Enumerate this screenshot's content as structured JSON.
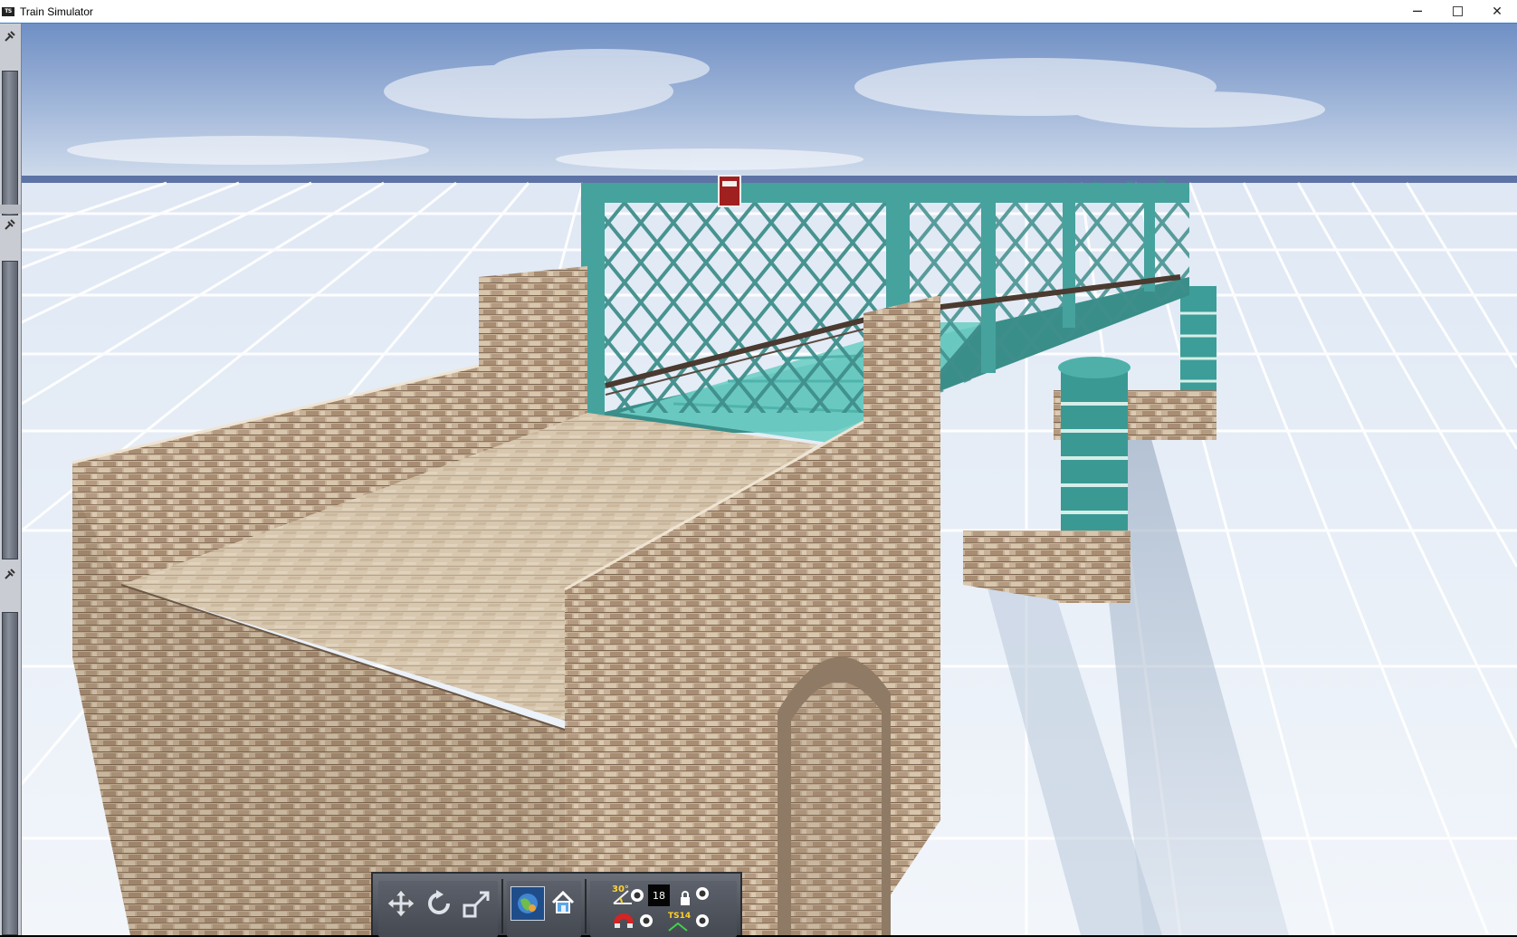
{
  "window": {
    "title": "Train Simulator",
    "app_icon_label": "TS",
    "controls": {
      "minimize": "─",
      "close": "✕"
    }
  },
  "sidebar": {
    "handles": [
      "pin-icon",
      "pin-icon",
      "pin-icon"
    ]
  },
  "toolbar": {
    "groups": [
      {
        "name": "camera-tools",
        "buttons": [
          "move-icon",
          "rotate-icon",
          "scale-icon"
        ]
      },
      {
        "name": "navigation",
        "buttons": [
          "world-globe-icon",
          "home-icon"
        ]
      },
      {
        "name": "settings",
        "buttons": [
          "30-degree-snap-icon",
          "snap-toggle",
          "grid-size",
          "lock-icon",
          "lock-toggle",
          "magnet-icon",
          "magnet-toggle",
          "ts14-icon",
          "ts14-toggle"
        ]
      }
    ],
    "snap_angle_label": "30°",
    "grid_size_value": "18",
    "ts_label": "TS14"
  },
  "colors": {
    "sky_top": "#6f8fc4",
    "sky_horizon": "#c9d6ea",
    "ground": "#e9f1f9",
    "grid_lines": "#ffffff",
    "bridge_steel": "#4aa3a0",
    "stone": "#c9b39a"
  }
}
